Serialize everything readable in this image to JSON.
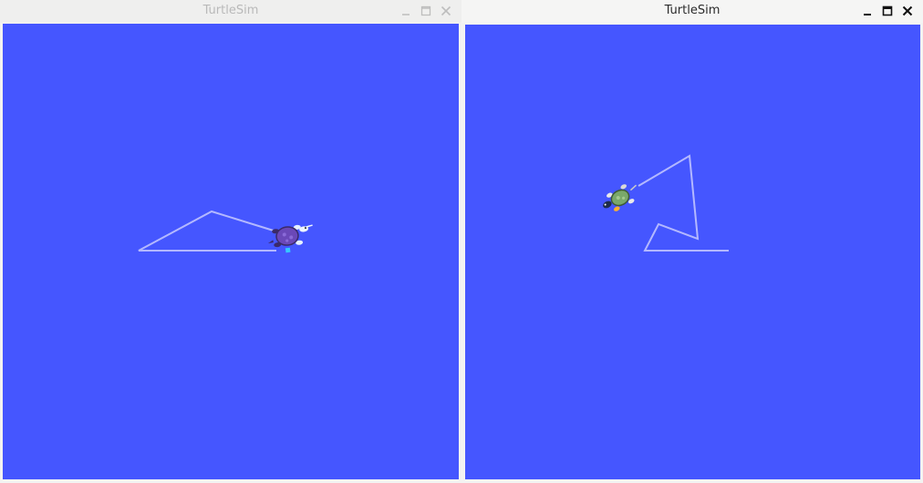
{
  "windows": [
    {
      "title": "TurtleSim",
      "active": false,
      "controls": [
        "minimize-icon",
        "maximize-icon",
        "close-icon"
      ],
      "turtle": "purple turtle",
      "background_color": "#4556ff",
      "pen_color": "#b3b8ff"
    },
    {
      "title": "TurtleSim",
      "active": true,
      "controls": [
        "minimize-icon",
        "maximize-icon",
        "close-icon"
      ],
      "turtle": "green turtle",
      "background_color": "#4556ff",
      "pen_color": "#b3b8ff"
    }
  ],
  "colors": {
    "inactive_title": "#b9b9b9",
    "active_title": "#2b2b2b",
    "canvas": "#4556ff",
    "trail": "#b3b8ff"
  }
}
